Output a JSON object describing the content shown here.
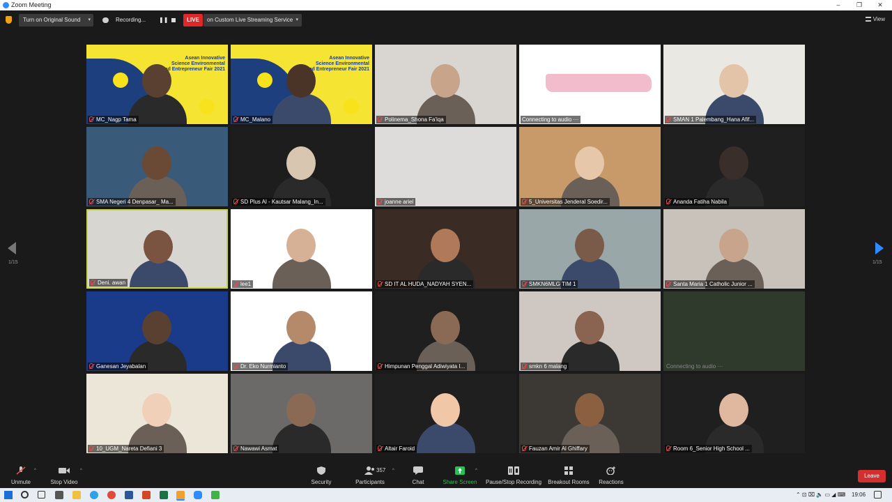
{
  "window": {
    "title": "Zoom Meeting",
    "min": "–",
    "max": "❐",
    "close": "✕"
  },
  "topbar": {
    "sound_button": "Turn on Original Sound",
    "recording_label": "Recording...",
    "pause_glyph": "❚❚",
    "live_badge": "LIVE",
    "live_service": "on Custom Live Streaming Service",
    "view_label": "View"
  },
  "pagination": {
    "left": "1/15",
    "right": "1/15"
  },
  "tiles": [
    {
      "name": "MC_Nagp Tama",
      "banner": true
    },
    {
      "name": "MC_Malano",
      "banner": true
    },
    {
      "name": "Polinema_Shona Fa'iqa"
    },
    {
      "name": "Connecting to audio ···",
      "connecting": true
    },
    {
      "name": "SMAN 1 Palembang_Hana Afif..."
    },
    {
      "name": "SMA Negeri 4 Denpasar_ Ma..."
    },
    {
      "name": "SD Plus Al - Kautsar Malang_In..."
    },
    {
      "name": "joanne ariel"
    },
    {
      "name": "5_Universitas Jenderal Soedir..."
    },
    {
      "name": "Ananda Fatiha Nabila"
    },
    {
      "name": "Deni. awan",
      "active": true
    },
    {
      "name": "lee1"
    },
    {
      "name": "SD IT AL HUDA_NADYAH SYEN..."
    },
    {
      "name": "SMKN6MLG TIM 1"
    },
    {
      "name": "Santa Maria 1 Catholic Junior ..."
    },
    {
      "name": "Ganesan Jeyabalan"
    },
    {
      "name": "Dr. Eko Nurmianto"
    },
    {
      "name": "Himpunan Penggal Adiwiyata I..."
    },
    {
      "name": "smkn 6 malang"
    },
    {
      "name": "Connecting to audio ···",
      "connecting": true,
      "nolabel": true
    },
    {
      "name": "10_UGM_Nareta Defiani 3"
    },
    {
      "name": "Nawawi Asmat"
    },
    {
      "name": "Altair Faroid"
    },
    {
      "name": "Fauzan Amir Al Ghiffary"
    },
    {
      "name": "Room 6_Senior High School ..."
    }
  ],
  "banner_text": "Asean Innovative\nScience Environmental\nand Entrepreneur Fair 2021",
  "toolbar": {
    "unmute": "Unmute",
    "stop_video": "Stop Video",
    "security": "Security",
    "participants": "Participants",
    "participants_count": "357",
    "chat": "Chat",
    "share_screen": "Share Screen",
    "pause_recording": "Pause/Stop Recording",
    "breakout": "Breakout Rooms",
    "reactions": "Reactions",
    "leave": "Leave"
  },
  "taskbar": {
    "time": "19:06"
  },
  "colors": {
    "accent": "#2d8cff",
    "live": "#e02828",
    "leave": "#d32f2f",
    "share": "#23c552",
    "active_border": "#c9d54b"
  }
}
